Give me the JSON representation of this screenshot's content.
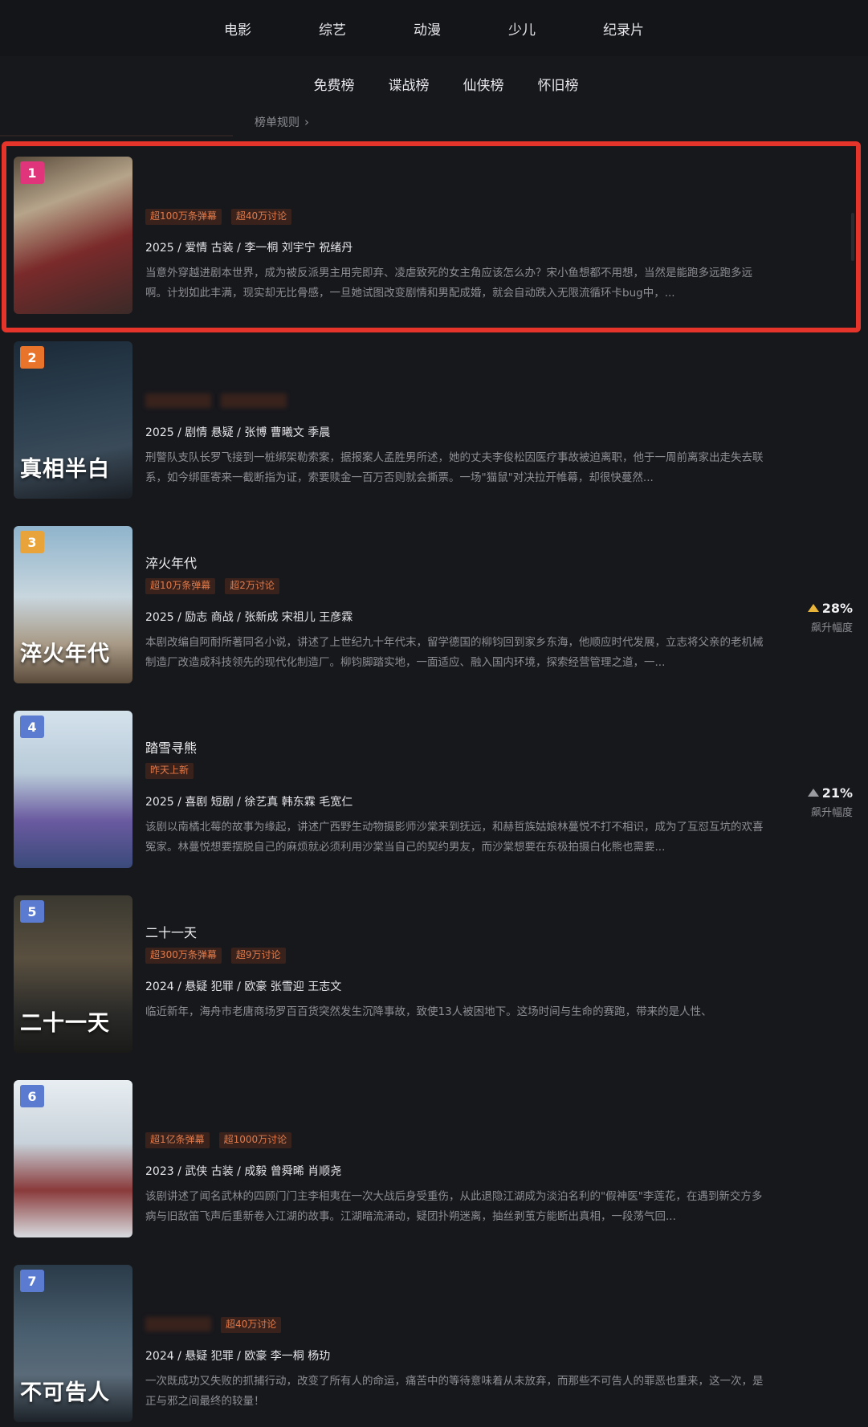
{
  "top_categories": [
    "电影",
    "综艺",
    "动漫",
    "少儿",
    "纪录片"
  ],
  "sub_categories": [
    "免费榜",
    "谍战榜",
    "仙侠榜",
    "怀旧榜"
  ],
  "rules_label": "榜单规则",
  "colors": {
    "accent": "#e5352b",
    "tag_text": "#e07a4a",
    "trend_up": "#e8b43a"
  },
  "items": [
    {
      "rank": "1",
      "rank_color": "#e0357a",
      "title": "",
      "title_blurred": true,
      "tags": [
        {
          "text": "超100万条弹幕",
          "blur": false
        },
        {
          "text": "超40万讨论",
          "blur": false
        }
      ],
      "meta": "2025 / 爱情 古装 / 李一桐 刘宇宁 祝绪丹",
      "desc": "当意外穿越进剧本世界，成为被反派男主用完即弃、凌虐致死的女主角应该怎么办？宋小鱼想都不用想，当然是能跑多远跑多远啊。计划如此丰满，现实却无比骨感，一旦她试图改变剧情和男配成婚，就会自动跌入无限流循环卡bug中，...",
      "poster_bg": "linear-gradient(160deg,#5a4c3c 0%,#b6a48a 30%,#7a2a2a 60%,#3a2a28 100%)",
      "poster_text": "",
      "trend": null
    },
    {
      "rank": "2",
      "rank_color": "#e8742c",
      "title": "",
      "title_blurred": true,
      "tags": [
        {
          "text": "",
          "blur": true
        },
        {
          "text": "",
          "blur": true
        }
      ],
      "meta": "2025 / 剧情 悬疑 / 张博 曹曦文 季晨",
      "desc": "刑警队支队长罗飞接到一桩绑架勒索案，据报案人孟胜男所述，她的丈夫李俊松因医疗事故被迫离职，他于一周前离家出走失去联系，如今绑匪寄来一截断指为证，索要赎金一百万否则就会撕票。一场\"猫鼠\"对决拉开帷幕，却很快蔓然...",
      "poster_bg": "linear-gradient(170deg,#1c2a38 0%,#2c4050 45%,#3a4a58 70%,#1a1e24 100%)",
      "poster_text": "真相半白",
      "trend": null
    },
    {
      "rank": "3",
      "rank_color": "#e8a33a",
      "title": "淬火年代",
      "title_blurred": false,
      "tags": [
        {
          "text": "超10万条弹幕",
          "blur": false
        },
        {
          "text": "超2万讨论",
          "blur": false
        }
      ],
      "meta": "2025 / 励志 商战 / 张新成 宋祖儿 王彦霖",
      "desc": "本剧改编自阿耐所著同名小说，讲述了上世纪九十年代末，留学德国的柳钧回到家乡东海，他顺应时代发展，立志将父亲的老机械制造厂改造成科技领先的现代化制造厂。柳钧脚踏实地，一面适应、融入国内环境，探索经营管理之道，一...",
      "poster_bg": "linear-gradient(180deg,#8fb4cc 0%,#c8d6de 45%,#a89a86 75%,#5a4a3a 100%)",
      "poster_text": "淬火年代",
      "trend": {
        "pct": "28%",
        "label": "飙升幅度",
        "gold": true
      }
    },
    {
      "rank": "4",
      "rank_color": "#5b7bd0",
      "title": "踏雪寻熊",
      "title_blurred": false,
      "tags": [
        {
          "text": "昨天上新",
          "blur": false
        }
      ],
      "meta": "2025 / 喜剧 短剧 / 徐艺真 韩东霖 毛宽仁",
      "desc": "该剧以南橘北莓的故事为缘起，讲述广西野生动物摄影师沙棠来到抚远，和赫哲族姑娘林蔓悦不打不相识，成为了互怼互坑的欢喜冤家。林蔓悦想要摆脱自己的麻烦就必须利用沙棠当自己的契约男友，而沙棠想要在东极拍摄白化熊也需要...",
      "poster_bg": "linear-gradient(180deg,#d4e2ec 0%,#b8cad8 40%,#6a5aa0 70%,#3a4a7a 100%)",
      "poster_text": "",
      "trend": {
        "pct": "21%",
        "label": "飙升幅度",
        "gold": false
      }
    },
    {
      "rank": "5",
      "rank_color": "#5b7bd0",
      "title": "二十一天",
      "title_blurred": false,
      "tags": [
        {
          "text": "超300万条弹幕",
          "blur": false
        },
        {
          "text": "超9万讨论",
          "blur": false
        }
      ],
      "meta": "2024 / 悬疑 犯罪 / 欧豪 张雪迎 王志文",
      "desc": "临近新年，海舟市老唐商场罗百百货突然发生沉降事故，致使13人被困地下。这场时间与生命的赛跑，带来的是人性、",
      "poster_bg": "linear-gradient(180deg,#3a3830 0%,#5a5040 40%,#2a2a28 75%,#1a1a18 100%)",
      "poster_text": "二十一天",
      "trend": null
    },
    {
      "rank": "6",
      "rank_color": "#5b7bd0",
      "title": "",
      "title_blurred": true,
      "tags": [
        {
          "text": "超1亿条弹幕",
          "blur": false
        },
        {
          "text": "超1000万讨论",
          "blur": false
        }
      ],
      "meta": "2023 / 武侠 古装 / 成毅 曾舜晞 肖顺尧",
      "desc": "该剧讲述了闻名武林的四顾门门主李相夷在一次大战后身受重伤，从此退隐江湖成为淡泊名利的\"假神医\"李莲花，在遇到新交方多病与旧敌笛飞声后重新卷入江湖的故事。江湖暗流涌动，疑团扑朔迷离，抽丝剥茧方能断出真相，一段荡气回...",
      "poster_bg": "linear-gradient(180deg,#e8eef2 0%,#c8d2da 40%,#8a3a3a 70%,#d8dce0 100%)",
      "poster_text": "",
      "trend": null
    },
    {
      "rank": "7",
      "rank_color": "#5b7bd0",
      "title": "",
      "title_blurred": true,
      "tags": [
        {
          "text": "",
          "blur": true
        },
        {
          "text": "超40万讨论",
          "blur": false
        }
      ],
      "meta": "2024 / 悬疑 犯罪 / 欧豪 李一桐 杨玏",
      "desc": "一次既成功又失败的抓捕行动，改变了所有人的命运，痛苦中的等待意味着从未放弃，而那些不可告人的罪恶也重来，这一次，是正与邪之间最终的较量！",
      "poster_bg": "linear-gradient(180deg,#2a3a48 0%,#4a6070 45%,#5a6a78 70%,#1c2228 100%)",
      "poster_text": "不可告人",
      "trend": null
    }
  ]
}
